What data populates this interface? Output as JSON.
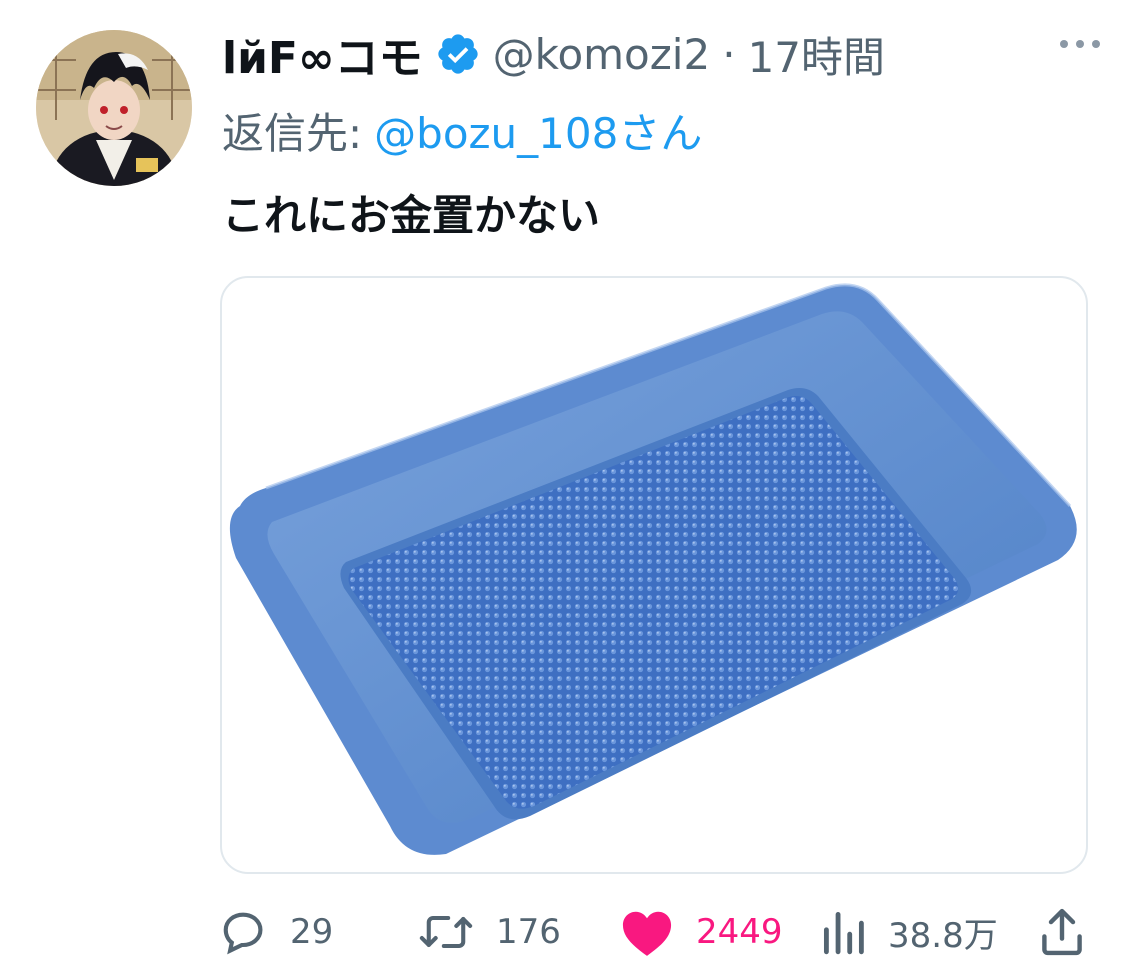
{
  "tweet": {
    "display_name": "lйF∞コモ",
    "handle": "@komozi2",
    "separator": "·",
    "time_ago": "17時間",
    "reply_prefix": "返信先:",
    "reply_target": "@bozu_108さん",
    "text": "これにお金置かない"
  },
  "actions": {
    "reply_count": "29",
    "retweet_count": "176",
    "like_count": "2449",
    "views_count": "38.8万"
  },
  "colors": {
    "accent_blue": "#1d9bf0",
    "like_pink": "#f91880",
    "muted": "#536471",
    "text": "#0f1419",
    "tray_blue": "#5f8fd0"
  },
  "icons": {
    "verified": "verified-badge-icon",
    "more": "more-icon",
    "reply": "reply-icon",
    "retweet": "retweet-icon",
    "like": "heart-icon",
    "views": "views-icon",
    "share": "share-icon"
  }
}
